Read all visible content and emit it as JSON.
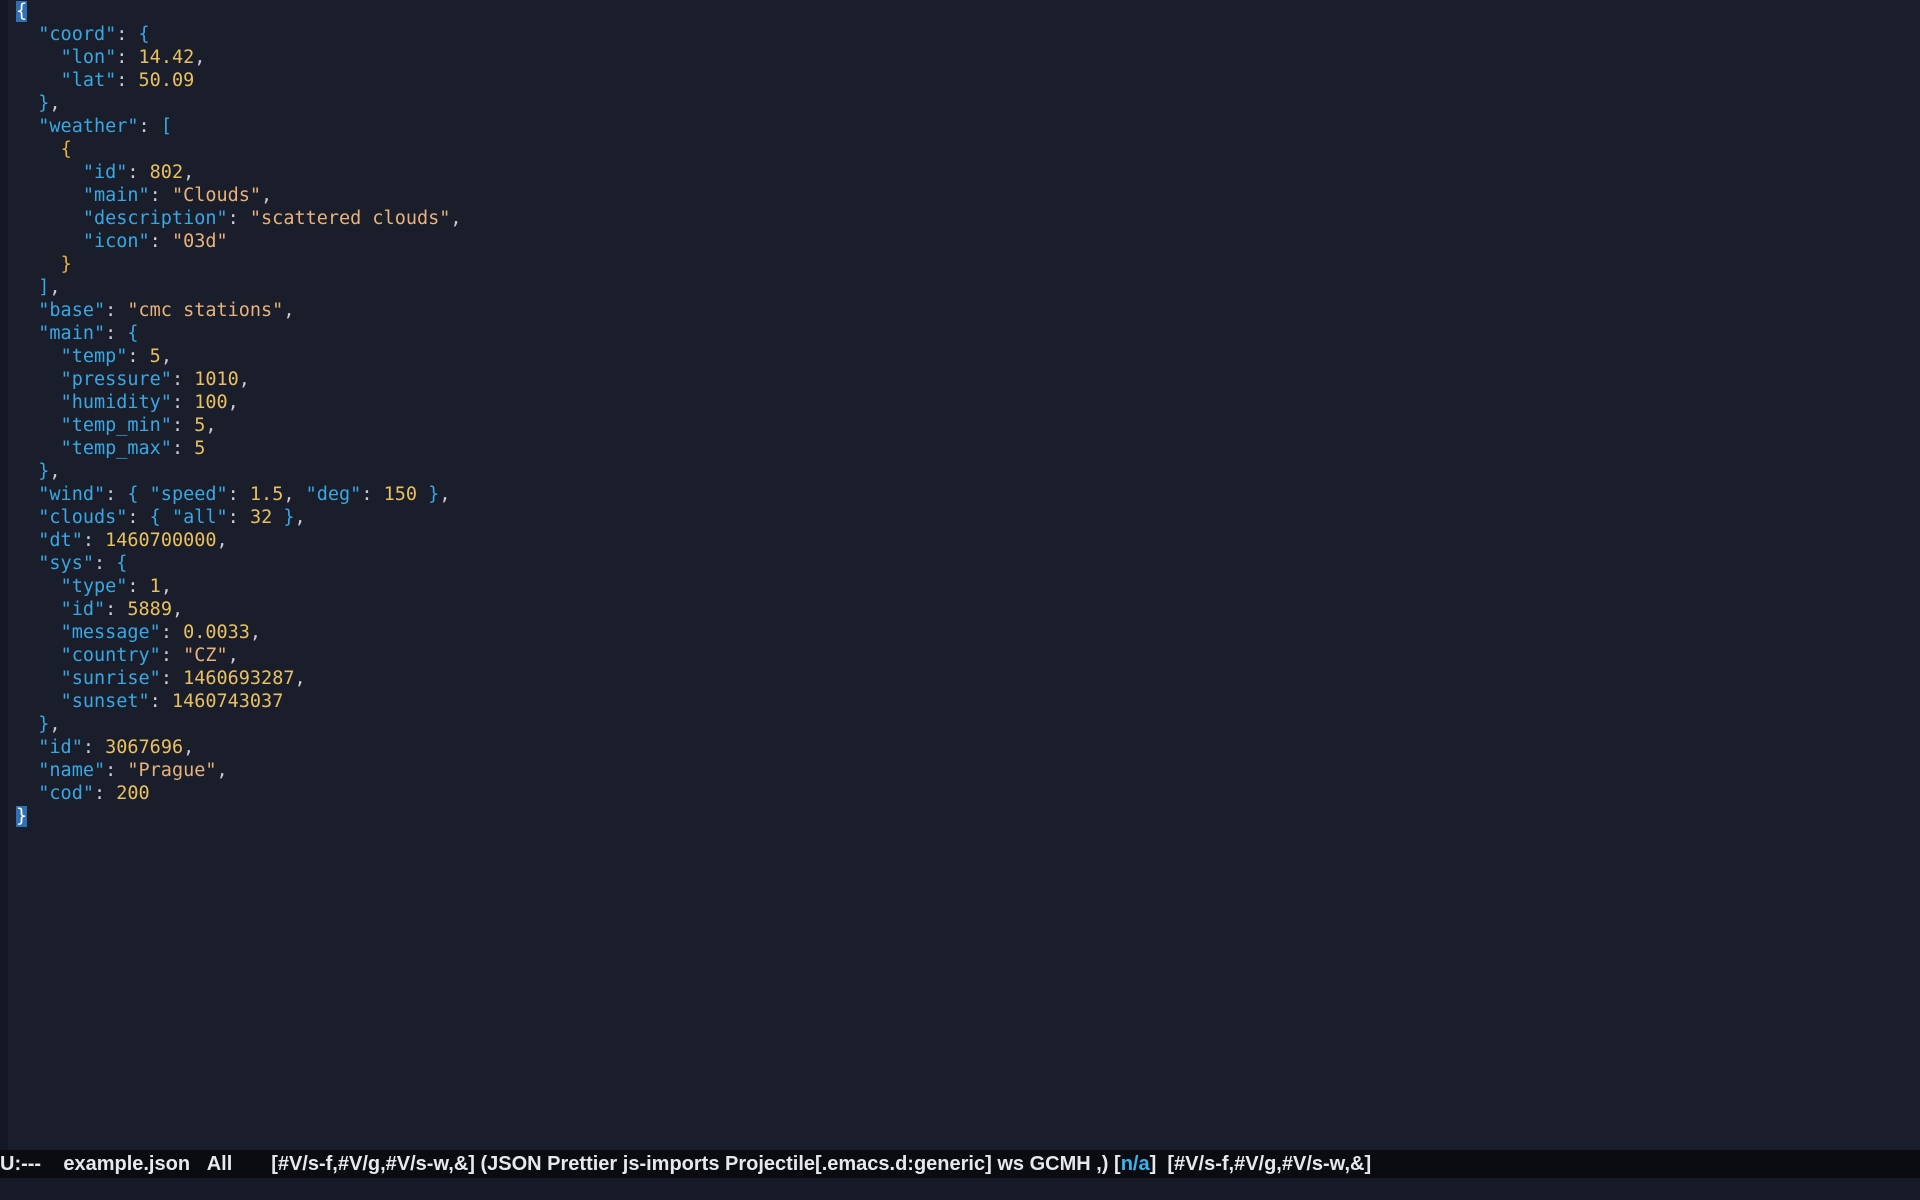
{
  "window": {
    "title": "example.json"
  },
  "buffer": {
    "lines": [
      [
        {
          "t": "{",
          "c": "brk cursor"
        }
      ],
      [
        {
          "t": "  "
        },
        {
          "t": "\"coord\"",
          "c": "key"
        },
        {
          "t": ": ",
          "c": "pun"
        },
        {
          "t": "{",
          "c": "brk"
        }
      ],
      [
        {
          "t": "    "
        },
        {
          "t": "\"lon\"",
          "c": "key"
        },
        {
          "t": ": ",
          "c": "pun"
        },
        {
          "t": "14.42",
          "c": "num"
        },
        {
          "t": ",",
          "c": "pun"
        }
      ],
      [
        {
          "t": "    "
        },
        {
          "t": "\"lat\"",
          "c": "key"
        },
        {
          "t": ": ",
          "c": "pun"
        },
        {
          "t": "50.09",
          "c": "num"
        }
      ],
      [
        {
          "t": "  "
        },
        {
          "t": "}",
          "c": "brk"
        },
        {
          "t": ",",
          "c": "pun"
        }
      ],
      [
        {
          "t": "  "
        },
        {
          "t": "\"weather\"",
          "c": "key"
        },
        {
          "t": ": ",
          "c": "pun"
        },
        {
          "t": "[",
          "c": "brk"
        }
      ],
      [
        {
          "t": "    "
        },
        {
          "t": "{",
          "c": "brk2"
        }
      ],
      [
        {
          "t": "      "
        },
        {
          "t": "\"id\"",
          "c": "key"
        },
        {
          "t": ": ",
          "c": "pun"
        },
        {
          "t": "802",
          "c": "num"
        },
        {
          "t": ",",
          "c": "pun"
        }
      ],
      [
        {
          "t": "      "
        },
        {
          "t": "\"main\"",
          "c": "key"
        },
        {
          "t": ": ",
          "c": "pun"
        },
        {
          "t": "\"Clouds\"",
          "c": "str"
        },
        {
          "t": ",",
          "c": "pun"
        }
      ],
      [
        {
          "t": "      "
        },
        {
          "t": "\"description\"",
          "c": "key"
        },
        {
          "t": ": ",
          "c": "pun"
        },
        {
          "t": "\"scattered clouds\"",
          "c": "str"
        },
        {
          "t": ",",
          "c": "pun"
        }
      ],
      [
        {
          "t": "      "
        },
        {
          "t": "\"icon\"",
          "c": "key"
        },
        {
          "t": ": ",
          "c": "pun"
        },
        {
          "t": "\"03d\"",
          "c": "str"
        }
      ],
      [
        {
          "t": "    "
        },
        {
          "t": "}",
          "c": "brk2"
        }
      ],
      [
        {
          "t": "  "
        },
        {
          "t": "]",
          "c": "brk"
        },
        {
          "t": ",",
          "c": "pun"
        }
      ],
      [
        {
          "t": "  "
        },
        {
          "t": "\"base\"",
          "c": "key"
        },
        {
          "t": ": ",
          "c": "pun"
        },
        {
          "t": "\"cmc stations\"",
          "c": "str"
        },
        {
          "t": ",",
          "c": "pun"
        }
      ],
      [
        {
          "t": "  "
        },
        {
          "t": "\"main\"",
          "c": "key"
        },
        {
          "t": ": ",
          "c": "pun"
        },
        {
          "t": "{",
          "c": "brk"
        }
      ],
      [
        {
          "t": "    "
        },
        {
          "t": "\"temp\"",
          "c": "key"
        },
        {
          "t": ": ",
          "c": "pun"
        },
        {
          "t": "5",
          "c": "num"
        },
        {
          "t": ",",
          "c": "pun"
        }
      ],
      [
        {
          "t": "    "
        },
        {
          "t": "\"pressure\"",
          "c": "key"
        },
        {
          "t": ": ",
          "c": "pun"
        },
        {
          "t": "1010",
          "c": "num"
        },
        {
          "t": ",",
          "c": "pun"
        }
      ],
      [
        {
          "t": "    "
        },
        {
          "t": "\"humidity\"",
          "c": "key"
        },
        {
          "t": ": ",
          "c": "pun"
        },
        {
          "t": "100",
          "c": "num"
        },
        {
          "t": ",",
          "c": "pun"
        }
      ],
      [
        {
          "t": "    "
        },
        {
          "t": "\"temp_min\"",
          "c": "key"
        },
        {
          "t": ": ",
          "c": "pun"
        },
        {
          "t": "5",
          "c": "num"
        },
        {
          "t": ",",
          "c": "pun"
        }
      ],
      [
        {
          "t": "    "
        },
        {
          "t": "\"temp_max\"",
          "c": "key"
        },
        {
          "t": ": ",
          "c": "pun"
        },
        {
          "t": "5",
          "c": "num"
        }
      ],
      [
        {
          "t": "  "
        },
        {
          "t": "}",
          "c": "brk"
        },
        {
          "t": ",",
          "c": "pun"
        }
      ],
      [
        {
          "t": "  "
        },
        {
          "t": "\"wind\"",
          "c": "key"
        },
        {
          "t": ": ",
          "c": "pun"
        },
        {
          "t": "{",
          "c": "brk"
        },
        {
          "t": " "
        },
        {
          "t": "\"speed\"",
          "c": "key"
        },
        {
          "t": ": ",
          "c": "pun"
        },
        {
          "t": "1.5",
          "c": "num"
        },
        {
          "t": ", ",
          "c": "pun"
        },
        {
          "t": "\"deg\"",
          "c": "key"
        },
        {
          "t": ": ",
          "c": "pun"
        },
        {
          "t": "150",
          "c": "num"
        },
        {
          "t": " "
        },
        {
          "t": "}",
          "c": "brk"
        },
        {
          "t": ",",
          "c": "pun"
        }
      ],
      [
        {
          "t": "  "
        },
        {
          "t": "\"clouds\"",
          "c": "key"
        },
        {
          "t": ": ",
          "c": "pun"
        },
        {
          "t": "{",
          "c": "brk"
        },
        {
          "t": " "
        },
        {
          "t": "\"all\"",
          "c": "key"
        },
        {
          "t": ": ",
          "c": "pun"
        },
        {
          "t": "32",
          "c": "num"
        },
        {
          "t": " "
        },
        {
          "t": "}",
          "c": "brk"
        },
        {
          "t": ",",
          "c": "pun"
        }
      ],
      [
        {
          "t": "  "
        },
        {
          "t": "\"dt\"",
          "c": "key"
        },
        {
          "t": ": ",
          "c": "pun"
        },
        {
          "t": "1460700000",
          "c": "num"
        },
        {
          "t": ",",
          "c": "pun"
        }
      ],
      [
        {
          "t": "  "
        },
        {
          "t": "\"sys\"",
          "c": "key"
        },
        {
          "t": ": ",
          "c": "pun"
        },
        {
          "t": "{",
          "c": "brk"
        }
      ],
      [
        {
          "t": "    "
        },
        {
          "t": "\"type\"",
          "c": "key"
        },
        {
          "t": ": ",
          "c": "pun"
        },
        {
          "t": "1",
          "c": "num"
        },
        {
          "t": ",",
          "c": "pun"
        }
      ],
      [
        {
          "t": "    "
        },
        {
          "t": "\"id\"",
          "c": "key"
        },
        {
          "t": ": ",
          "c": "pun"
        },
        {
          "t": "5889",
          "c": "num"
        },
        {
          "t": ",",
          "c": "pun"
        }
      ],
      [
        {
          "t": "    "
        },
        {
          "t": "\"message\"",
          "c": "key"
        },
        {
          "t": ": ",
          "c": "pun"
        },
        {
          "t": "0.0033",
          "c": "num"
        },
        {
          "t": ",",
          "c": "pun"
        }
      ],
      [
        {
          "t": "    "
        },
        {
          "t": "\"country\"",
          "c": "key"
        },
        {
          "t": ": ",
          "c": "pun"
        },
        {
          "t": "\"CZ\"",
          "c": "str"
        },
        {
          "t": ",",
          "c": "pun"
        }
      ],
      [
        {
          "t": "    "
        },
        {
          "t": "\"sunrise\"",
          "c": "key"
        },
        {
          "t": ": ",
          "c": "pun"
        },
        {
          "t": "1460693287",
          "c": "num"
        },
        {
          "t": ",",
          "c": "pun"
        }
      ],
      [
        {
          "t": "    "
        },
        {
          "t": "\"sunset\"",
          "c": "key"
        },
        {
          "t": ": ",
          "c": "pun"
        },
        {
          "t": "1460743037",
          "c": "num"
        }
      ],
      [
        {
          "t": "  "
        },
        {
          "t": "}",
          "c": "brk"
        },
        {
          "t": ",",
          "c": "pun"
        }
      ],
      [
        {
          "t": "  "
        },
        {
          "t": "\"id\"",
          "c": "key"
        },
        {
          "t": ": ",
          "c": "pun"
        },
        {
          "t": "3067696",
          "c": "num"
        },
        {
          "t": ",",
          "c": "pun"
        }
      ],
      [
        {
          "t": "  "
        },
        {
          "t": "\"name\"",
          "c": "key"
        },
        {
          "t": ": ",
          "c": "pun"
        },
        {
          "t": "\"Prague\"",
          "c": "str"
        },
        {
          "t": ",",
          "c": "pun"
        }
      ],
      [
        {
          "t": "  "
        },
        {
          "t": "\"cod\"",
          "c": "key"
        },
        {
          "t": ": ",
          "c": "pun"
        },
        {
          "t": "200",
          "c": "num"
        }
      ],
      [
        {
          "t": "}",
          "c": "brk cursor"
        }
      ]
    ]
  },
  "modeline": {
    "status": "U:---",
    "filename": "example.json",
    "position": "All",
    "flags_left": "[#V/s-f,#V/g,#V/s-w,&]",
    "modes": "(JSON Prettier js-imports Projectile[.emacs.d:generic] ws GCMH ,)",
    "vc_open": "[",
    "vc_value": "n/a",
    "vc_close": "]",
    "flags_right": "[#V/s-f,#V/g,#V/s-w,&]"
  },
  "colors": {
    "background": "#1a1e2b",
    "key": "#39a7e3",
    "string": "#e8b27a",
    "number": "#e8c060",
    "modeline_bg": "#0a0c12",
    "accent": "#39b4ee"
  }
}
